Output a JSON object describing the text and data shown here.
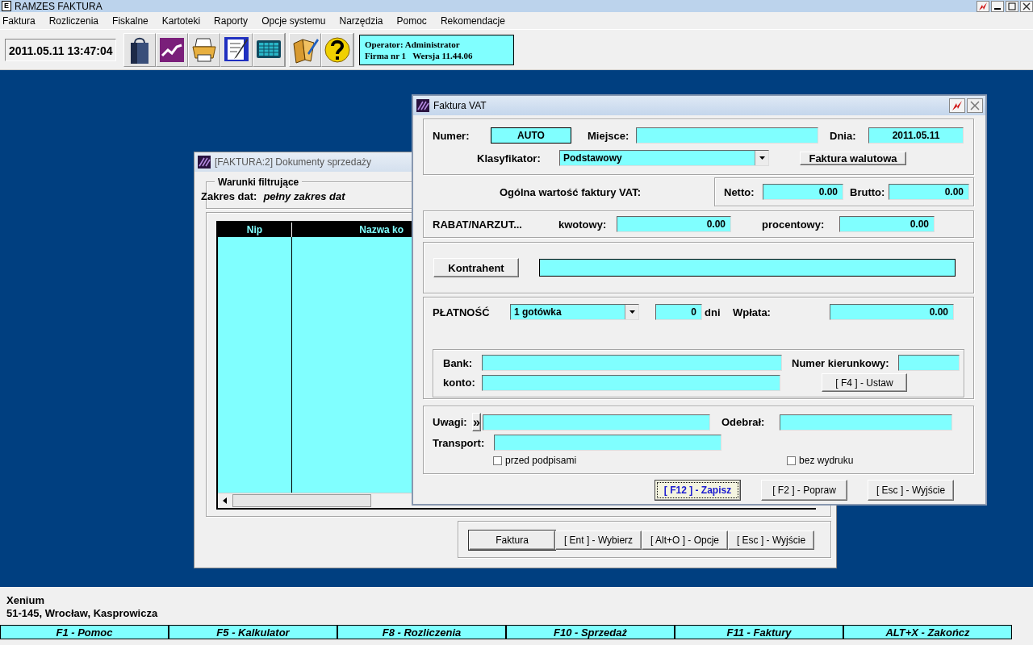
{
  "app": {
    "icon_letter": "E",
    "title": "RAMZES FAKTURA"
  },
  "menu": [
    "Faktura",
    "Rozliczenia",
    "Fiskalne",
    "Kartoteki",
    "Raporty",
    "Opcje systemu",
    "Narzędzia",
    "Pomoc",
    "Rekomendacje"
  ],
  "toolbar": {
    "datetime": "2011.05.11 13:47:04",
    "groups": [
      [
        {
          "kind": "bag"
        },
        {
          "kind": "chart"
        },
        {
          "kind": "printer"
        },
        {
          "kind": "form"
        },
        {
          "kind": "calculator"
        }
      ],
      [
        {
          "kind": "book"
        },
        {
          "kind": "help"
        }
      ]
    ],
    "info": [
      "Operator: Administrator",
      "Firma nr 1   Wersja 11.44.06"
    ]
  },
  "documents_window": {
    "title": "[FAKTURA:2]  Dokumenty sprzedaży",
    "filter_legend": "Warunki filtrujące",
    "filter_label": "Zakres dat:",
    "filter_value": "pełny zakres dat",
    "columns": [
      "Nip",
      "Nazwa ko"
    ],
    "buttons": [
      {
        "label": "Faktura",
        "selected": true
      },
      {
        "label": "[ Ent ] - Wybierz",
        "selected": false
      },
      {
        "label": "[ Alt+O ] - Opcje",
        "selected": false
      },
      {
        "label": "[ Esc ] - Wyjście",
        "selected": false
      }
    ]
  },
  "invoice_window": {
    "title": "Faktura VAT",
    "numer": {
      "label": "Numer:",
      "value": "AUTO"
    },
    "miejsce": {
      "label": "Miejsce:"
    },
    "dnia": {
      "label": "Dnia:",
      "value": "2011.05.11"
    },
    "klasyfikator": {
      "label": "Klasyfikator:",
      "value": "Podstawowy"
    },
    "currency_button": "Faktura walutowa",
    "total_label": "Ogólna wartość faktury VAT:",
    "netto": {
      "label": "Netto:",
      "value": "0.00"
    },
    "brutto": {
      "label": "Brutto:",
      "value": "0.00"
    },
    "rabat": {
      "label": "RABAT/NARZUT...",
      "kwotowy": {
        "label": "kwotowy:",
        "value": "0.00"
      },
      "procentowy": {
        "label": "procentowy:",
        "value": "0.00"
      }
    },
    "kontrahent_button": "Kontrahent",
    "platnosc": {
      "label": "PŁATNOŚĆ",
      "method": "1 gotówka",
      "days": "0",
      "days_unit": "dni",
      "wplata": {
        "label": "Wpłata:",
        "value": "0.00"
      }
    },
    "bank": {
      "label": "Bank:"
    },
    "konto": {
      "label": "konto:"
    },
    "numer_kierunkowy": {
      "label": "Numer kierunkowy:"
    },
    "ustaw_button": "[ F4 ] - Ustaw",
    "uwagi": {
      "label": "Uwagi:",
      "button": "»"
    },
    "transport": {
      "label": "Transport:"
    },
    "odebral": {
      "label": "Odebrał:"
    },
    "checkboxes": [
      {
        "label": "przed podpisami",
        "checked": false
      },
      {
        "label": "bez wydruku",
        "checked": false
      }
    ],
    "buttons": [
      {
        "label": "[ F12 ] - Zapisz",
        "selected": true
      },
      {
        "label": "[ F2 ] - Popraw",
        "selected": false
      },
      {
        "label": "[ Esc ] - Wyjście",
        "selected": false
      }
    ]
  },
  "company": {
    "name": "Xenium",
    "address": "51-145, Wrocław, Kasprowicza"
  },
  "function_keys": [
    "F1 - Pomoc",
    "F5 - Kalkulator",
    "F8 - Rozliczenia",
    "F10 - Sprzedaż",
    "F11 - Faktury",
    "ALT+X - Zakończ"
  ]
}
